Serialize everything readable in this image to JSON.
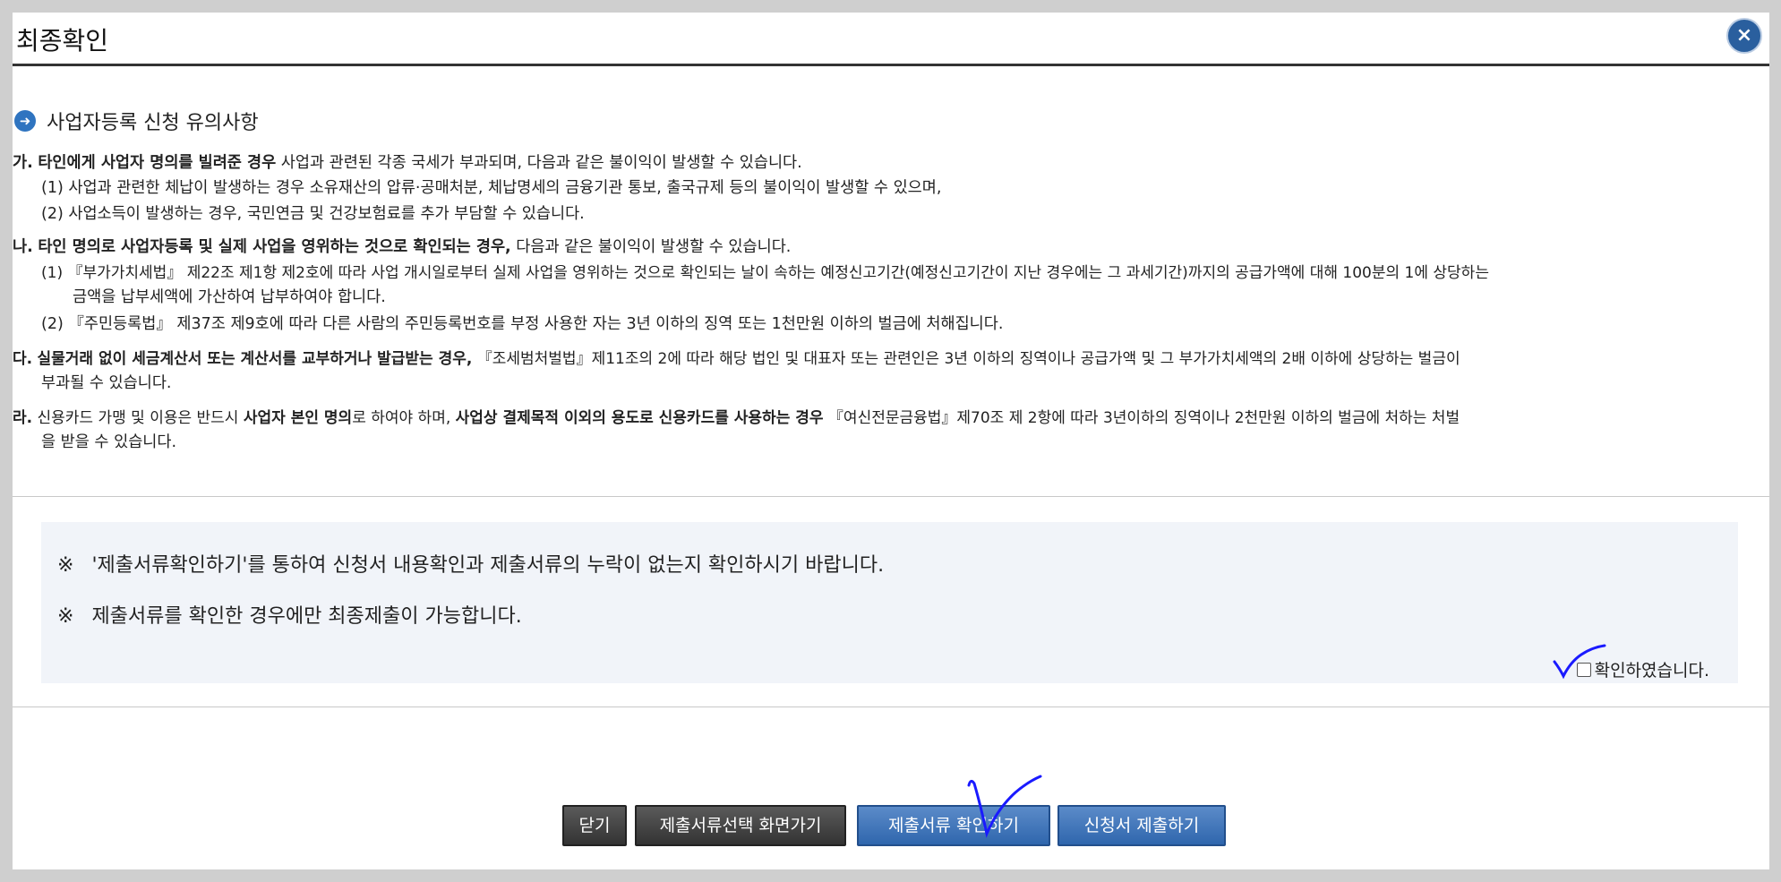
{
  "dialog": {
    "title": "최종확인",
    "close_label": "×",
    "section_title": "사업자등록 신청 유의사항"
  },
  "notice": {
    "ga": {
      "label": "가.",
      "bold": "타인에게 사업자 명의를 빌려준 경우",
      "text": " 사업과 관련된 각종 국세가 부과되며, 다음과 같은 불이익이 발생할 수 있습니다."
    },
    "ga1": "(1) 사업과 관련한 체납이 발생하는 경우 소유재산의 압류·공매처분, 체납명세의 금융기관 통보, 출국규제 등의 불이익이 발생할 수 있으며,",
    "ga2": "(2) 사업소득이 발생하는 경우, 국민연금 및 건강보험료를 추가 부담할 수 있습니다.",
    "na": {
      "label": "나.",
      "bold": "타인 명의로 사업자등록 및 실제 사업을 영위하는 것으로 확인되는 경우,",
      "text": " 다음과 같은 불이익이 발생할 수 있습니다."
    },
    "na1": "(1) 『부가가치세법』 제22조 제1항 제2호에 따라 사업 개시일로부터 실제 사업을 영위하는 것으로 확인되는 날이 속하는 예정신고기간(예정신고기간이 지난 경우에는 그 과세기간)까지의 공급가액에 대해 100분의 1에 상당하는",
    "na1b": "금액을 납부세액에 가산하여 납부하여야 합니다.",
    "na2": "(2) 『주민등록법』 제37조 제9호에 따라 다른 사람의 주민등록번호를 부정 사용한 자는 3년 이하의 징역 또는 1천만원 이하의 벌금에 처해집니다.",
    "da": {
      "label": "다.",
      "bold": "실물거래 없이 세금계산서 또는 계산서를 교부하거나 발급받는 경우,",
      "text": " 『조세범처벌법』제11조의 2에 따라 해당 법인 및 대표자 또는 관련인은 3년 이하의 징역이나 공급가액 및 그 부가가치세액의 2배 이하에 상당하는 벌금이"
    },
    "da_b": "부과될 수 있습니다.",
    "ra": {
      "label": "라.",
      "t1": " 신용카드 가맹 및 이용은 반드시 ",
      "b1": "사업자 본인 명의",
      "t2": "로 하여야 하며, ",
      "b2": "사업상 결제목적 이외의 용도로 신용카드를 사용하는 경우",
      "t3": " 『여신전문금융법』제70조 제 2항에 따라 3년이하의 징역이나 2천만원 이하의 벌금에 처하는 처벌"
    },
    "ra_b": "을 받을 수 있습니다."
  },
  "reference": {
    "mark": "※",
    "line1": "'제출서류확인하기'를 통하여 신청서 내용확인과 제출서류의 누락이 없는지 확인하시기 바랍니다.",
    "line2": "제출서류를 확인한 경우에만 최종제출이 가능합니다.",
    "confirm_label": "확인하였습니다."
  },
  "buttons": {
    "close": "닫기",
    "goto_select": "제출서류선택 화면가기",
    "check_docs": "제출서류 확인하기",
    "submit": "신청서 제출하기"
  },
  "colors": {
    "close_button": "#2a5f9e",
    "primary_button": "#3a72b8",
    "dark_button": "#444444",
    "pen_mark": "#1a1aff"
  }
}
